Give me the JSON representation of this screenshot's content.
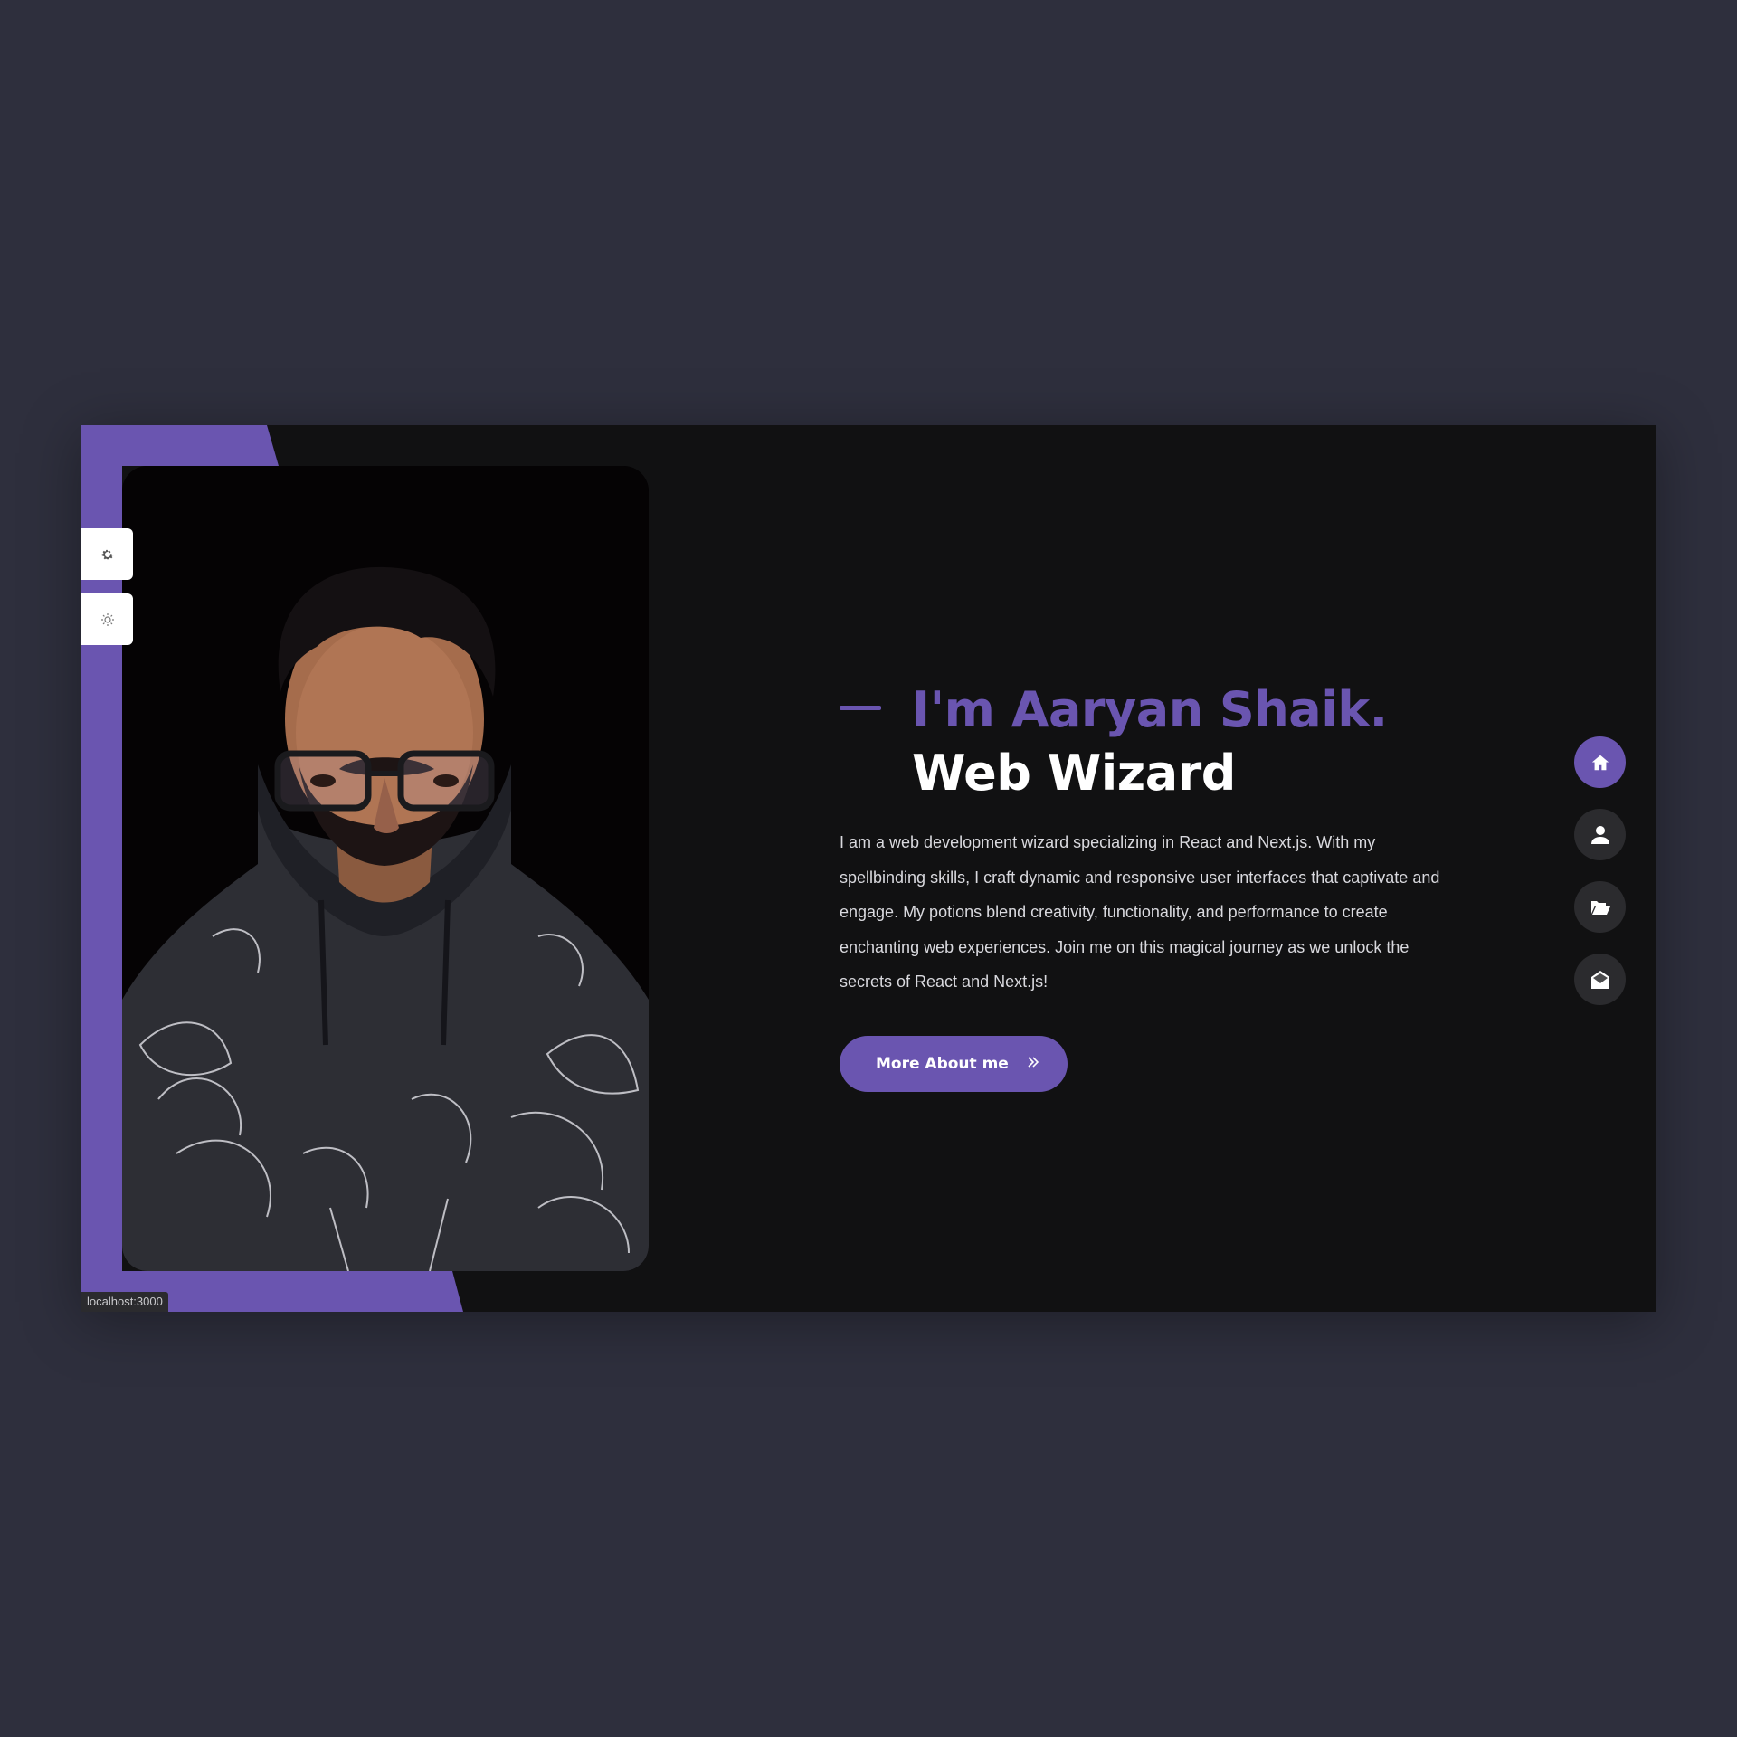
{
  "theme": {
    "accent": "#6a55b0",
    "page_bg": "#2e2f3d",
    "panel_bg": "#111112",
    "text": "#ffffff",
    "muted_text": "#d9d9de"
  },
  "side_tools": [
    {
      "icon": "gear-icon"
    },
    {
      "icon": "sun-icon"
    }
  ],
  "hero": {
    "name": "I'm Aaryan Shaik.",
    "role": "Web Wizard",
    "bio": "I am a web development wizard specializing in React and Next.js. With my spellbinding skills, I craft dynamic and responsive user interfaces that captivate and engage. My potions blend creativity, functionality, and performance to create enchanting web experiences. Join me on this magical journey as we unlock the secrets of React and Next.js!",
    "cta_label": "More About me",
    "cta_icon": "double-chevron-right-icon"
  },
  "nav": [
    {
      "icon": "home-icon",
      "active": true
    },
    {
      "icon": "user-icon",
      "active": false
    },
    {
      "icon": "folder-open-icon",
      "active": false
    },
    {
      "icon": "envelope-open-icon",
      "active": false
    }
  ],
  "status_bar": {
    "url": "localhost:3000"
  }
}
